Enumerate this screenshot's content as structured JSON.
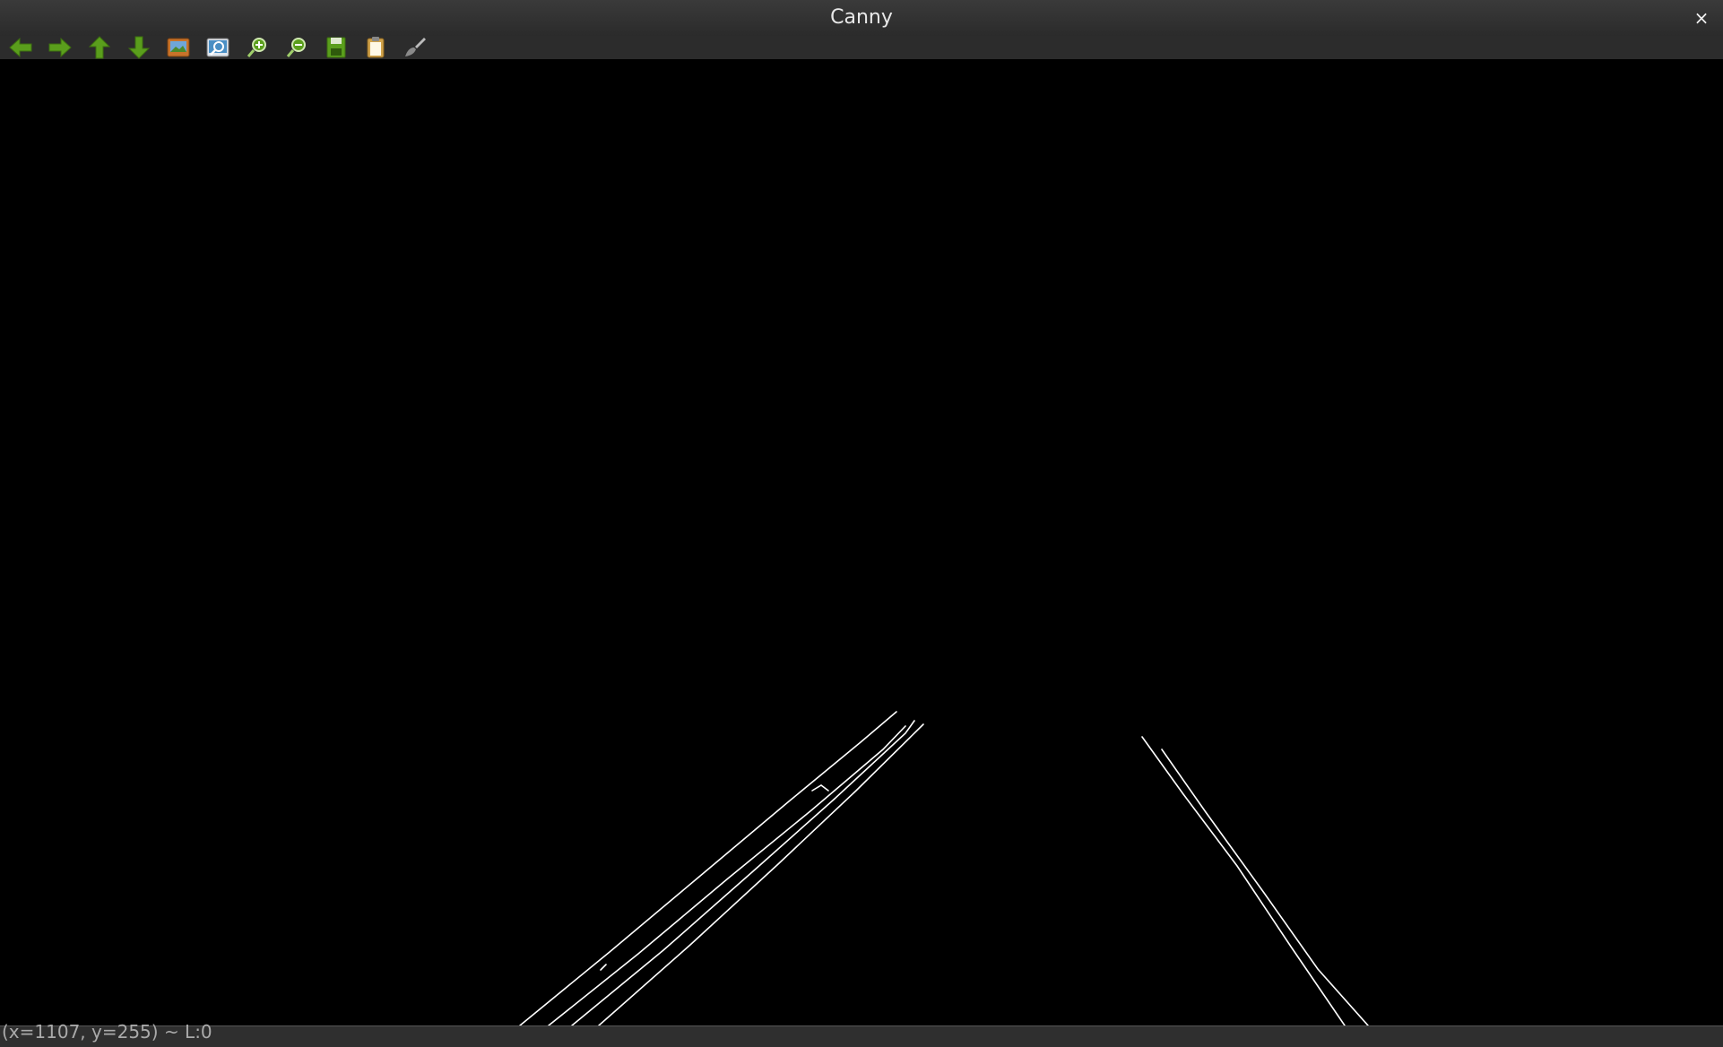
{
  "window": {
    "title": "Canny",
    "close_glyph": "×"
  },
  "toolbar": {
    "buttons": [
      {
        "name": "pan-left-button",
        "icon": "arrow-left-icon",
        "color": "#5a9e1c"
      },
      {
        "name": "pan-right-button",
        "icon": "arrow-right-icon",
        "color": "#5a9e1c"
      },
      {
        "name": "pan-up-button",
        "icon": "arrow-up-icon",
        "color": "#5a9e1c"
      },
      {
        "name": "pan-down-button",
        "icon": "arrow-down-icon",
        "color": "#5a9e1c"
      },
      {
        "name": "zoom-to-fit-button",
        "icon": "image-icon",
        "color": "#c8732a"
      },
      {
        "name": "zoom-original-button",
        "icon": "zoom-window-icon",
        "color": "#4a8fc4"
      },
      {
        "name": "zoom-in-button",
        "icon": "zoom-in-icon",
        "color": "#5a9e1c"
      },
      {
        "name": "zoom-out-button",
        "icon": "zoom-out-icon",
        "color": "#5a9e1c"
      },
      {
        "name": "save-button",
        "icon": "floppy-disk-icon",
        "color": "#5a9e1c"
      },
      {
        "name": "copy-button",
        "icon": "clipboard-icon",
        "color": "#d0a24a"
      },
      {
        "name": "properties-button",
        "icon": "brush-icon",
        "color": "#9a9a9a"
      }
    ]
  },
  "status": {
    "text": "(x=1107, y=255) ~ L:0"
  },
  "colors": {
    "edge": "#ffffff",
    "background": "#000000"
  }
}
